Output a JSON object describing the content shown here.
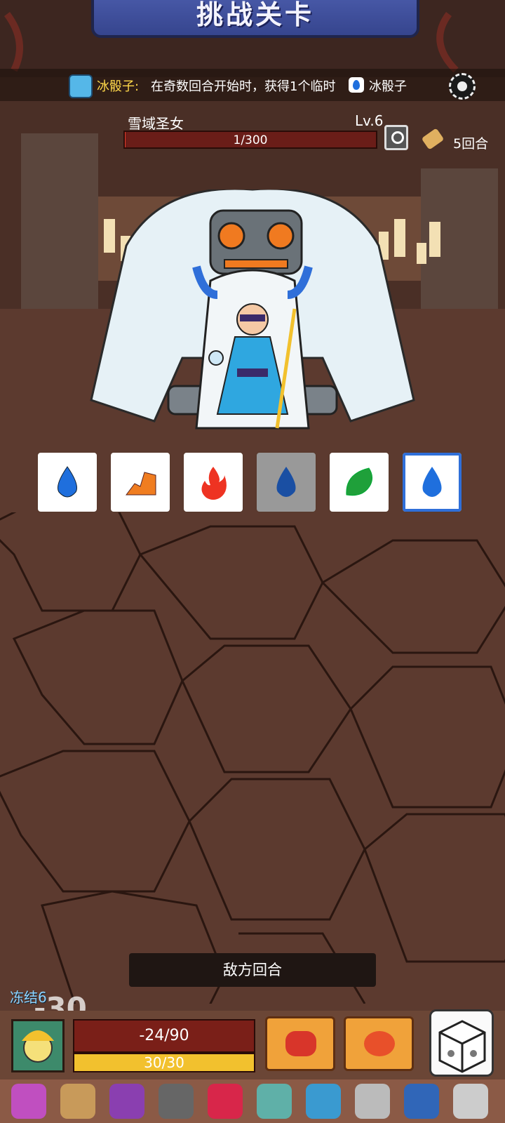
{
  "banner": {
    "title": "挑战关卡"
  },
  "hint": {
    "icon": "ice-dice-icon",
    "name": "冰骰子:",
    "text": "在奇数回合开始时，获得1个临时",
    "tail": "冰骰子"
  },
  "boss": {
    "name": "雪域圣女",
    "level": "Lv.6",
    "hp_text": "1/300",
    "hp_fraction": 0.0033
  },
  "turns": {
    "label": "5回合"
  },
  "dice": [
    {
      "type": "water",
      "color": "#1f6fdd",
      "state": "normal"
    },
    {
      "type": "earth",
      "color": "#f07d20",
      "state": "normal"
    },
    {
      "type": "fire",
      "color": "#ee3322",
      "state": "normal"
    },
    {
      "type": "water",
      "color": "#1a4fa3",
      "state": "used"
    },
    {
      "type": "wind",
      "color": "#1fa03a",
      "state": "normal"
    },
    {
      "type": "water",
      "color": "#1f6fdd",
      "state": "frozen"
    }
  ],
  "enemy_turn": {
    "label": "敌方回合"
  },
  "player": {
    "status": "冻结6",
    "damage_float": "-30",
    "hp_text": "-24/90",
    "shield_text": "30/30"
  },
  "skills": [
    {
      "icon": "spiked-fist-icon"
    },
    {
      "icon": "fire-burst-icon"
    }
  ],
  "relics": [
    {
      "icon": "totem-icon",
      "color": "#c04fc0"
    },
    {
      "icon": "horn-icon",
      "color": "#c89a5a"
    },
    {
      "icon": "skull-book-icon",
      "color": "#8a3fb0"
    },
    {
      "icon": "helmet-icon",
      "color": "#666"
    },
    {
      "icon": "ruby-amulet-icon",
      "color": "#d8264a"
    },
    {
      "icon": "urn-icon",
      "color": "#5fb0a8"
    },
    {
      "icon": "rainbow-orb-icon",
      "color": "#3a9ad0"
    },
    {
      "icon": "feather-icon",
      "color": "#bbbbbb"
    },
    {
      "icon": "demon-mask-icon",
      "color": "#3066b8"
    },
    {
      "icon": "ring-icon",
      "color": "#cccccc"
    }
  ]
}
